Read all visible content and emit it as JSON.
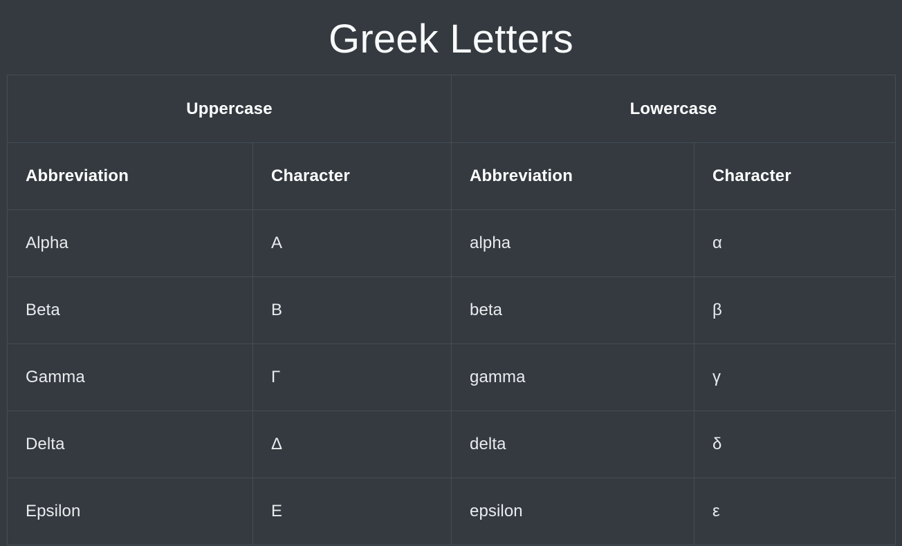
{
  "page": {
    "title": "Greek Letters",
    "background_color": "#343a40",
    "text_color": "#f1f3f5",
    "border_color": "#464d55"
  },
  "table": {
    "group_headers": [
      {
        "label": "Uppercase",
        "colspan": 2
      },
      {
        "label": "Lowercase",
        "colspan": 2
      }
    ],
    "column_headers": [
      "Abbreviation",
      "Character",
      "Abbreviation",
      "Character"
    ],
    "rows": [
      {
        "upper_abbr": "Alpha",
        "upper_char": "Α",
        "lower_abbr": "alpha",
        "lower_char": "α"
      },
      {
        "upper_abbr": "Beta",
        "upper_char": "Β",
        "lower_abbr": "beta",
        "lower_char": "β"
      },
      {
        "upper_abbr": "Gamma",
        "upper_char": "Γ",
        "lower_abbr": "gamma",
        "lower_char": "γ"
      },
      {
        "upper_abbr": "Delta",
        "upper_char": "Δ",
        "lower_abbr": "delta",
        "lower_char": "δ"
      },
      {
        "upper_abbr": "Epsilon",
        "upper_char": "Ε",
        "lower_abbr": "epsilon",
        "lower_char": "ε"
      }
    ]
  }
}
